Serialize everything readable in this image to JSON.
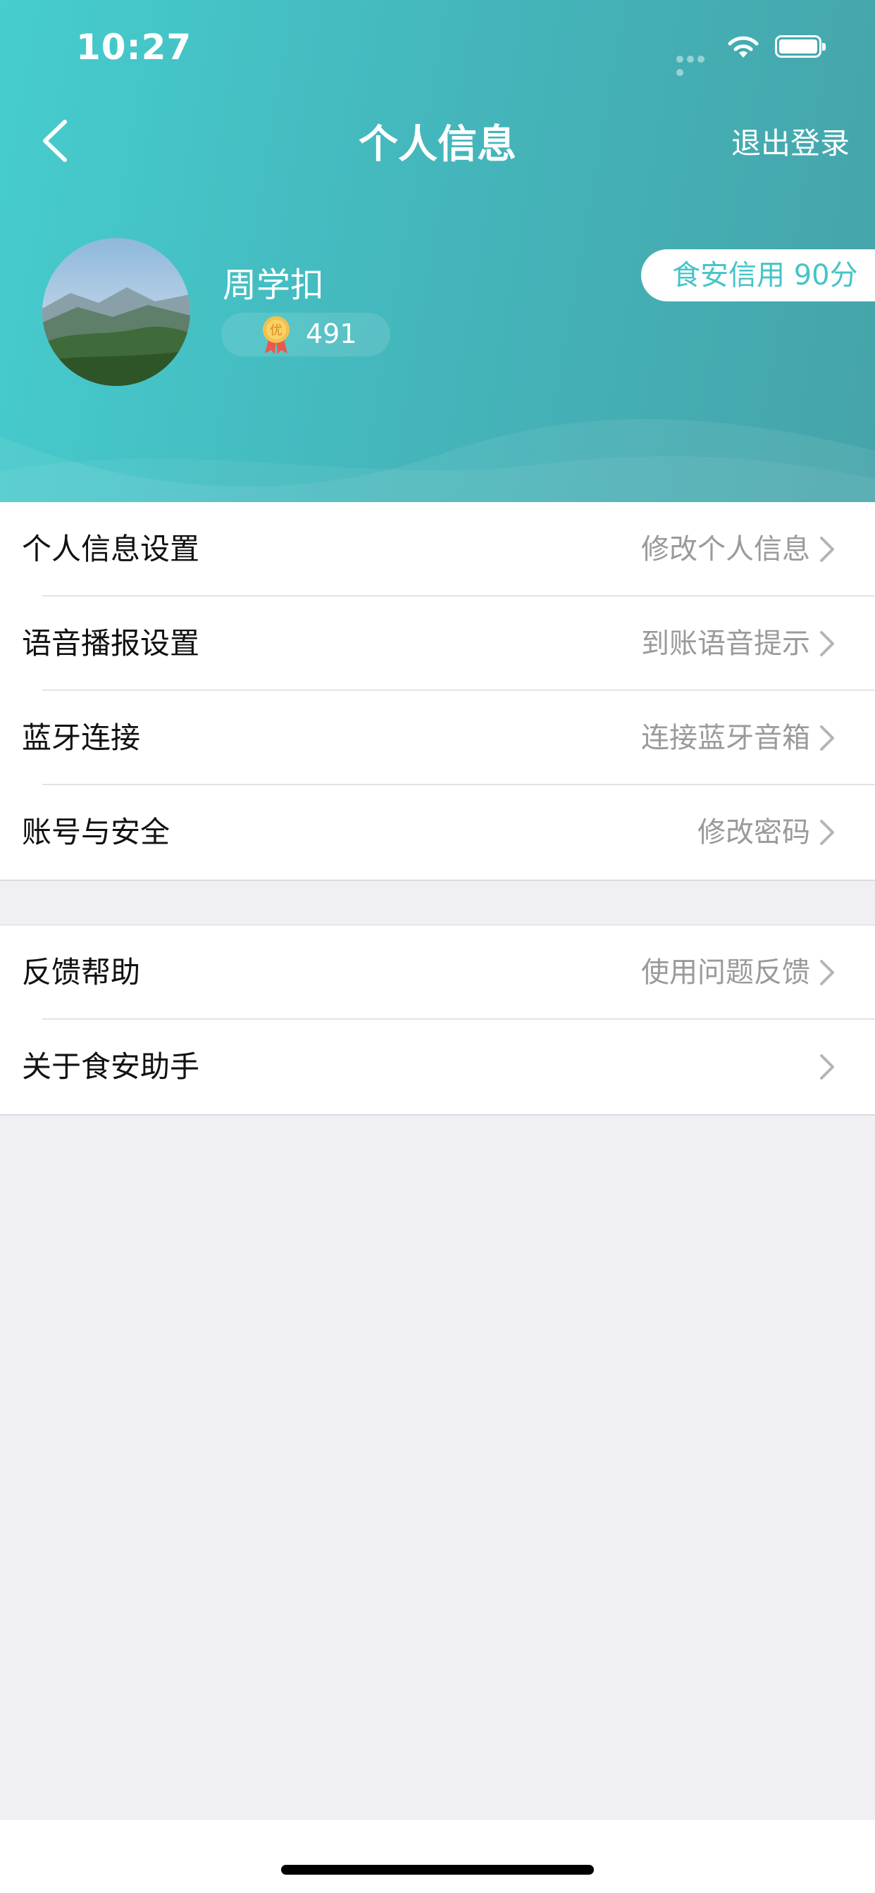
{
  "status_bar": {
    "time": "10:27"
  },
  "nav": {
    "title": "个人信息",
    "logout_label": "退出登录"
  },
  "profile": {
    "name": "周学扣",
    "points": "491",
    "medal_text": "优",
    "credit_label": "食安信用 90分"
  },
  "settings_group_1": [
    {
      "label": "个人信息设置",
      "hint": "修改个人信息"
    },
    {
      "label": "语音播报设置",
      "hint": "到账语音提示"
    },
    {
      "label": "蓝牙连接",
      "hint": "连接蓝牙音箱"
    },
    {
      "label": "账号与安全",
      "hint": "修改密码"
    }
  ],
  "settings_group_2": [
    {
      "label": "反馈帮助",
      "hint": "使用问题反馈"
    },
    {
      "label": "关于食安助手",
      "hint": ""
    }
  ],
  "colors": {
    "header_start": "#46cdcf",
    "header_end": "#45a4a9",
    "accent": "#46c4c6",
    "background": "#efeff4"
  }
}
